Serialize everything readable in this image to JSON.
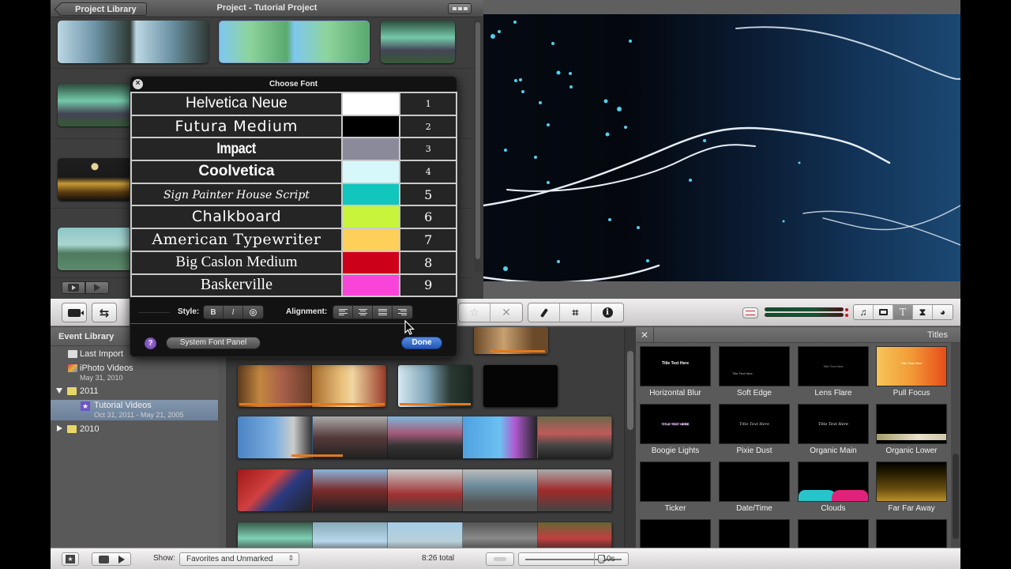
{
  "project": {
    "back_label": "Project Library",
    "title": "Project - Tutorial Project"
  },
  "font_dialog": {
    "title": "Choose Font",
    "fonts": [
      {
        "name": "Helvetica Neue",
        "color": "#ffffff",
        "number": "1"
      },
      {
        "name": "Futura Medium",
        "color": "#000000",
        "number": "2"
      },
      {
        "name": "Impact",
        "color": "#8a8a9a",
        "number": "3"
      },
      {
        "name": "Coolvetica",
        "color": "#d6f8fb",
        "number": "4"
      },
      {
        "name": "Sign Painter House Script",
        "color": "#10c6bd",
        "number": "5"
      },
      {
        "name": "Chalkboard",
        "color": "#c8f53c",
        "number": "6"
      },
      {
        "name": "American Typewriter",
        "color": "#fdd05a",
        "number": "7"
      },
      {
        "name": "Big Caslon Medium",
        "color": "#cc0019",
        "number": "8"
      },
      {
        "name": "Baskerville",
        "color": "#f944d9",
        "number": "9"
      }
    ],
    "style_label": "Style:",
    "style_buttons": [
      "B",
      "I",
      "O"
    ],
    "alignment_label": "Alignment:",
    "alignment_buttons": [
      "left",
      "center",
      "justify",
      "right"
    ],
    "help_label": "?",
    "system_font_panel_label": "System Font Panel",
    "done_label": "Done"
  },
  "event_library": {
    "header": "Event Library",
    "items": [
      {
        "label": "Last Import",
        "sub": ""
      },
      {
        "label": "iPhoto Videos",
        "sub": "May 31, 2010"
      },
      {
        "label": "2011",
        "sub": ""
      },
      {
        "label": "Tutorial Videos",
        "sub": "Oct 31, 2011 - May 21, 2005"
      },
      {
        "label": "2010",
        "sub": ""
      }
    ]
  },
  "titles": {
    "header": "Titles",
    "close_label": "✕",
    "items": [
      {
        "label": "Horizontal Blur",
        "preview": "Title Text Here"
      },
      {
        "label": "Soft Edge",
        "preview": "Title Text Here"
      },
      {
        "label": "Lens Flare",
        "preview": "Title Text Here"
      },
      {
        "label": "Pull Focus",
        "preview": "Title Text Here"
      },
      {
        "label": "Boogie Lights",
        "preview": "TITLE TEXT HERE"
      },
      {
        "label": "Pixie Dust",
        "preview": "Title Text Here"
      },
      {
        "label": "Organic Main",
        "preview": "Title Text Here"
      },
      {
        "label": "Organic Lower",
        "preview": ""
      },
      {
        "label": "Ticker",
        "preview": ""
      },
      {
        "label": "Date/Time",
        "preview": ""
      },
      {
        "label": "Clouds",
        "preview": ""
      },
      {
        "label": "Far Far Away",
        "preview": ""
      }
    ]
  },
  "bottom_bar": {
    "show_label": "Show:",
    "show_value": "Favorites and Unmarked",
    "total": "8:26 total",
    "zoom_value": "10s",
    "zoom_fraction": 0.78
  },
  "colors": {
    "done_blue": "#1f56b8",
    "selection_blue": "#7a8ea5",
    "orange_favorite": "#e07a1f"
  }
}
